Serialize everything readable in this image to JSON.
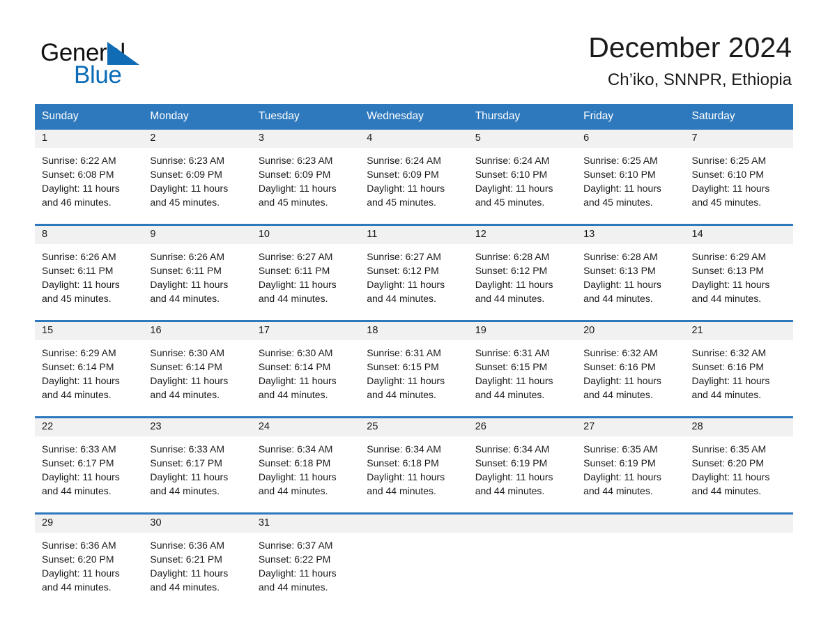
{
  "brand": {
    "logo_text_1": "General",
    "logo_text_2": "Blue",
    "logo_triangle_icon": "triangle-icon",
    "accent_color": "#2e79bd",
    "logo_blue_color": "#0a6cb8"
  },
  "header": {
    "title": "December 2024",
    "subtitle": "Ch’iko, SNNPR, Ethiopia"
  },
  "calendar": {
    "day_headers": [
      "Sunday",
      "Monday",
      "Tuesday",
      "Wednesday",
      "Thursday",
      "Friday",
      "Saturday"
    ],
    "weeks": [
      [
        {
          "day": "1",
          "sunrise": "Sunrise: 6:22 AM",
          "sunset": "Sunset: 6:08 PM",
          "daylight": "Daylight: 11 hours and 46 minutes."
        },
        {
          "day": "2",
          "sunrise": "Sunrise: 6:23 AM",
          "sunset": "Sunset: 6:09 PM",
          "daylight": "Daylight: 11 hours and 45 minutes."
        },
        {
          "day": "3",
          "sunrise": "Sunrise: 6:23 AM",
          "sunset": "Sunset: 6:09 PM",
          "daylight": "Daylight: 11 hours and 45 minutes."
        },
        {
          "day": "4",
          "sunrise": "Sunrise: 6:24 AM",
          "sunset": "Sunset: 6:09 PM",
          "daylight": "Daylight: 11 hours and 45 minutes."
        },
        {
          "day": "5",
          "sunrise": "Sunrise: 6:24 AM",
          "sunset": "Sunset: 6:10 PM",
          "daylight": "Daylight: 11 hours and 45 minutes."
        },
        {
          "day": "6",
          "sunrise": "Sunrise: 6:25 AM",
          "sunset": "Sunset: 6:10 PM",
          "daylight": "Daylight: 11 hours and 45 minutes."
        },
        {
          "day": "7",
          "sunrise": "Sunrise: 6:25 AM",
          "sunset": "Sunset: 6:10 PM",
          "daylight": "Daylight: 11 hours and 45 minutes."
        }
      ],
      [
        {
          "day": "8",
          "sunrise": "Sunrise: 6:26 AM",
          "sunset": "Sunset: 6:11 PM",
          "daylight": "Daylight: 11 hours and 45 minutes."
        },
        {
          "day": "9",
          "sunrise": "Sunrise: 6:26 AM",
          "sunset": "Sunset: 6:11 PM",
          "daylight": "Daylight: 11 hours and 44 minutes."
        },
        {
          "day": "10",
          "sunrise": "Sunrise: 6:27 AM",
          "sunset": "Sunset: 6:11 PM",
          "daylight": "Daylight: 11 hours and 44 minutes."
        },
        {
          "day": "11",
          "sunrise": "Sunrise: 6:27 AM",
          "sunset": "Sunset: 6:12 PM",
          "daylight": "Daylight: 11 hours and 44 minutes."
        },
        {
          "day": "12",
          "sunrise": "Sunrise: 6:28 AM",
          "sunset": "Sunset: 6:12 PM",
          "daylight": "Daylight: 11 hours and 44 minutes."
        },
        {
          "day": "13",
          "sunrise": "Sunrise: 6:28 AM",
          "sunset": "Sunset: 6:13 PM",
          "daylight": "Daylight: 11 hours and 44 minutes."
        },
        {
          "day": "14",
          "sunrise": "Sunrise: 6:29 AM",
          "sunset": "Sunset: 6:13 PM",
          "daylight": "Daylight: 11 hours and 44 minutes."
        }
      ],
      [
        {
          "day": "15",
          "sunrise": "Sunrise: 6:29 AM",
          "sunset": "Sunset: 6:14 PM",
          "daylight": "Daylight: 11 hours and 44 minutes."
        },
        {
          "day": "16",
          "sunrise": "Sunrise: 6:30 AM",
          "sunset": "Sunset: 6:14 PM",
          "daylight": "Daylight: 11 hours and 44 minutes."
        },
        {
          "day": "17",
          "sunrise": "Sunrise: 6:30 AM",
          "sunset": "Sunset: 6:14 PM",
          "daylight": "Daylight: 11 hours and 44 minutes."
        },
        {
          "day": "18",
          "sunrise": "Sunrise: 6:31 AM",
          "sunset": "Sunset: 6:15 PM",
          "daylight": "Daylight: 11 hours and 44 minutes."
        },
        {
          "day": "19",
          "sunrise": "Sunrise: 6:31 AM",
          "sunset": "Sunset: 6:15 PM",
          "daylight": "Daylight: 11 hours and 44 minutes."
        },
        {
          "day": "20",
          "sunrise": "Sunrise: 6:32 AM",
          "sunset": "Sunset: 6:16 PM",
          "daylight": "Daylight: 11 hours and 44 minutes."
        },
        {
          "day": "21",
          "sunrise": "Sunrise: 6:32 AM",
          "sunset": "Sunset: 6:16 PM",
          "daylight": "Daylight: 11 hours and 44 minutes."
        }
      ],
      [
        {
          "day": "22",
          "sunrise": "Sunrise: 6:33 AM",
          "sunset": "Sunset: 6:17 PM",
          "daylight": "Daylight: 11 hours and 44 minutes."
        },
        {
          "day": "23",
          "sunrise": "Sunrise: 6:33 AM",
          "sunset": "Sunset: 6:17 PM",
          "daylight": "Daylight: 11 hours and 44 minutes."
        },
        {
          "day": "24",
          "sunrise": "Sunrise: 6:34 AM",
          "sunset": "Sunset: 6:18 PM",
          "daylight": "Daylight: 11 hours and 44 minutes."
        },
        {
          "day": "25",
          "sunrise": "Sunrise: 6:34 AM",
          "sunset": "Sunset: 6:18 PM",
          "daylight": "Daylight: 11 hours and 44 minutes."
        },
        {
          "day": "26",
          "sunrise": "Sunrise: 6:34 AM",
          "sunset": "Sunset: 6:19 PM",
          "daylight": "Daylight: 11 hours and 44 minutes."
        },
        {
          "day": "27",
          "sunrise": "Sunrise: 6:35 AM",
          "sunset": "Sunset: 6:19 PM",
          "daylight": "Daylight: 11 hours and 44 minutes."
        },
        {
          "day": "28",
          "sunrise": "Sunrise: 6:35 AM",
          "sunset": "Sunset: 6:20 PM",
          "daylight": "Daylight: 11 hours and 44 minutes."
        }
      ],
      [
        {
          "day": "29",
          "sunrise": "Sunrise: 6:36 AM",
          "sunset": "Sunset: 6:20 PM",
          "daylight": "Daylight: 11 hours and 44 minutes."
        },
        {
          "day": "30",
          "sunrise": "Sunrise: 6:36 AM",
          "sunset": "Sunset: 6:21 PM",
          "daylight": "Daylight: 11 hours and 44 minutes."
        },
        {
          "day": "31",
          "sunrise": "Sunrise: 6:37 AM",
          "sunset": "Sunset: 6:22 PM",
          "daylight": "Daylight: 11 hours and 44 minutes."
        },
        {
          "day": "",
          "sunrise": "",
          "sunset": "",
          "daylight": ""
        },
        {
          "day": "",
          "sunrise": "",
          "sunset": "",
          "daylight": ""
        },
        {
          "day": "",
          "sunrise": "",
          "sunset": "",
          "daylight": ""
        },
        {
          "day": "",
          "sunrise": "",
          "sunset": "",
          "daylight": ""
        }
      ]
    ]
  }
}
